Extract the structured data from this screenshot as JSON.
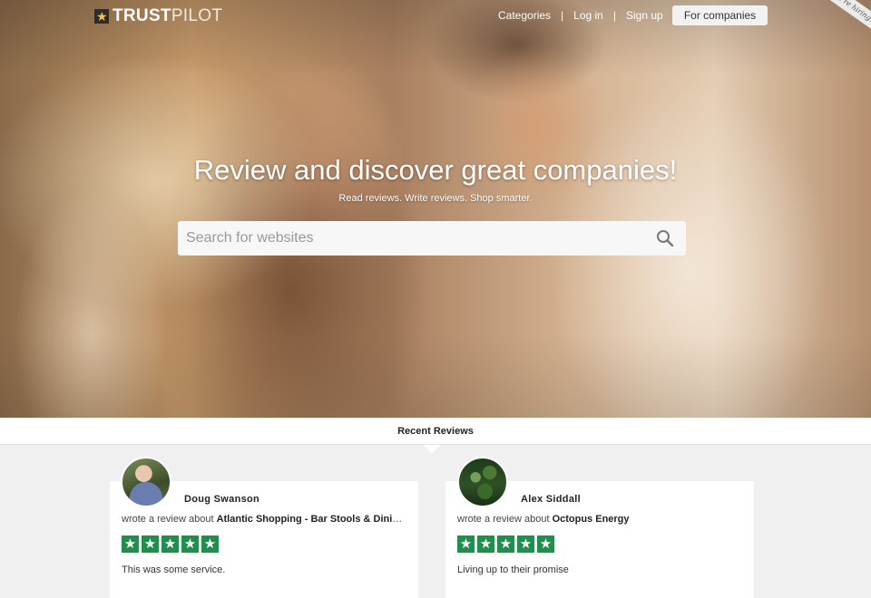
{
  "brand": {
    "name_bold": "TRUST",
    "name_light": "PILOT",
    "logo_icon": "star-icon"
  },
  "nav": {
    "categories": "Categories",
    "login": "Log in",
    "signup": "Sign up",
    "separator": "|",
    "for_companies": "For companies"
  },
  "ribbon": "We're hiring!",
  "hero": {
    "title": "Review and discover great companies!",
    "subtitle": "Read reviews. Write reviews. Shop smarter.",
    "search_placeholder": "Search for websites",
    "search_icon": "search-icon"
  },
  "recent_reviews": {
    "heading": "Recent Reviews",
    "items": [
      {
        "reviewer": "Doug Swanson",
        "prefix": "wrote a review about ",
        "company": "Atlantic Shopping - Bar Stools & Dining Chairs",
        "rating": 5,
        "text": "This was some service."
      },
      {
        "reviewer": "Alex Siddall",
        "prefix": "wrote a review about ",
        "company": "Octopus Energy",
        "rating": 5,
        "text": "Living up to their promise"
      }
    ]
  },
  "colors": {
    "star_green": "#1f8f4d",
    "button_bg": "#f2f2f2",
    "logo_mark": "#f7c34a"
  }
}
